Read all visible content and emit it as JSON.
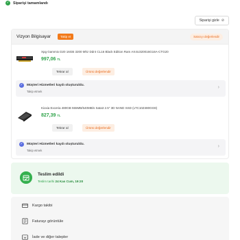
{
  "status": {
    "text": "Siparişi tamamlandı"
  },
  "header": {
    "invoice_button": "Siparişi gizle"
  },
  "store": {
    "name": "Vizyon Bilgisayar",
    "follow_label": "Takip et",
    "rate_seller_label": "Satıcıyı değerlendir"
  },
  "products": [
    {
      "title": "Xpg Gammix D20 16GB 3200 Mhz Ddr4 CL16 Black Edition Ram AX4U320016G16A-CTG20",
      "price": "997,06",
      "currency": "TL",
      "reorder_label": "Tekrar al",
      "rate_label": "Ürünü değerlendir"
    },
    {
      "title": "Kioxia Exceria 480GB 555MB/540MB/s Sata3 2.5\" 3D NAND SSD (LTC10Z480GG8)",
      "price": "827,39",
      "currency": "TL",
      "reorder_label": "Tekrar al",
      "rate_label": "Ürünü değerlendir"
    }
  ],
  "customer_service": [
    {
      "title": "Müşteri Hizmetleri kaydı oluşturuldu.",
      "subtitle": "Takip etmek"
    },
    {
      "title": "Müşteri Hizmetleri kaydı oluşturuldu.",
      "subtitle": "Takip etmek"
    }
  ],
  "delivery": {
    "title": "Teslim edildi",
    "date_label": "Teslim tarihi",
    "date_value": "24 Kas Cum, 19:20"
  },
  "actions": [
    {
      "label": "Kargo takibi",
      "icon": "truck-icon"
    },
    {
      "label": "Faturayı görüntüle",
      "icon": "invoice-icon"
    },
    {
      "label": "İade ve diğer talepler",
      "icon": "return-icon"
    }
  ],
  "colors": {
    "accent": "#f27a1a",
    "success": "#2fa34a",
    "info": "#5b6ee0"
  }
}
